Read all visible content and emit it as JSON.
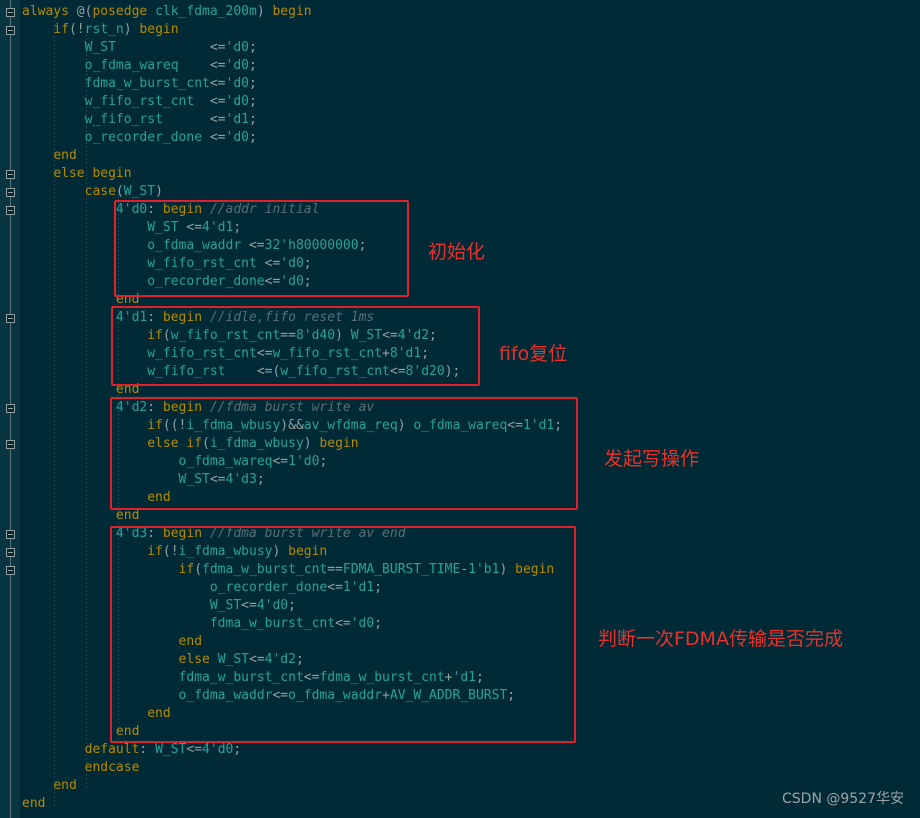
{
  "code_lines": [
    "always @(posedge clk_fdma_200m) begin",
    "    if(!rst_n) begin",
    "        W_ST            <='d0;",
    "        o_fdma_wareq    <='d0;",
    "        fdma_w_burst_cnt<='d0;",
    "        w_fifo_rst_cnt  <='d0;",
    "        w_fifo_rst      <='d1;",
    "        o_recorder_done <='d0;",
    "    end",
    "    else begin",
    "        case(W_ST)",
    "            4'd0: begin //addr initial",
    "                W_ST <=4'd1;",
    "                o_fdma_waddr <=32'h80000000;",
    "                w_fifo_rst_cnt <='d0;",
    "                o_recorder_done<='d0;",
    "            end",
    "            4'd1: begin //idle,fifo reset 1ms",
    "                if(w_fifo_rst_cnt==8'd40) W_ST<=4'd2;",
    "                w_fifo_rst_cnt<=w_fifo_rst_cnt+8'd1;",
    "                w_fifo_rst    <=(w_fifo_rst_cnt<=8'd20);",
    "            end",
    "            4'd2: begin //fdma burst write av",
    "                if((!i_fdma_wbusy)&&av_wfdma_req) o_fdma_wareq<=1'd1;",
    "                else if(i_fdma_wbusy) begin",
    "                    o_fdma_wareq<=1'd0;",
    "                    W_ST<=4'd3;",
    "                end",
    "            end",
    "            4'd3: begin //fdma burst write av end",
    "                if(!i_fdma_wbusy) begin",
    "                    if(fdma_w_burst_cnt==FDMA_BURST_TIME-1'b1) begin",
    "                        o_recorder_done<=1'd1;",
    "                        W_ST<=4'd0;",
    "                        fdma_w_burst_cnt<='d0;",
    "                    end",
    "                    else W_ST<=4'd2;",
    "                    fdma_w_burst_cnt<=fdma_w_burst_cnt+'d1;",
    "                    o_fdma_waddr<=o_fdma_waddr+AV_W_ADDR_BURST;",
    "                end",
    "            end",
    "        default: W_ST<=4'd0;",
    "        endcase",
    "    end",
    "end"
  ],
  "annotations": {
    "init": "初始化",
    "fifo_reset": "fifo复位",
    "start_write": "发起写操作",
    "check_done": "判断一次FDMA传输是否完成"
  },
  "watermark": "CSDN @9527华安",
  "colors": {
    "background": "#002b36",
    "keyword": "#b58900",
    "identifier": "#2aa198",
    "comment": "#586e75",
    "annotation": "#e8312a",
    "box_border": "#e0202a"
  }
}
